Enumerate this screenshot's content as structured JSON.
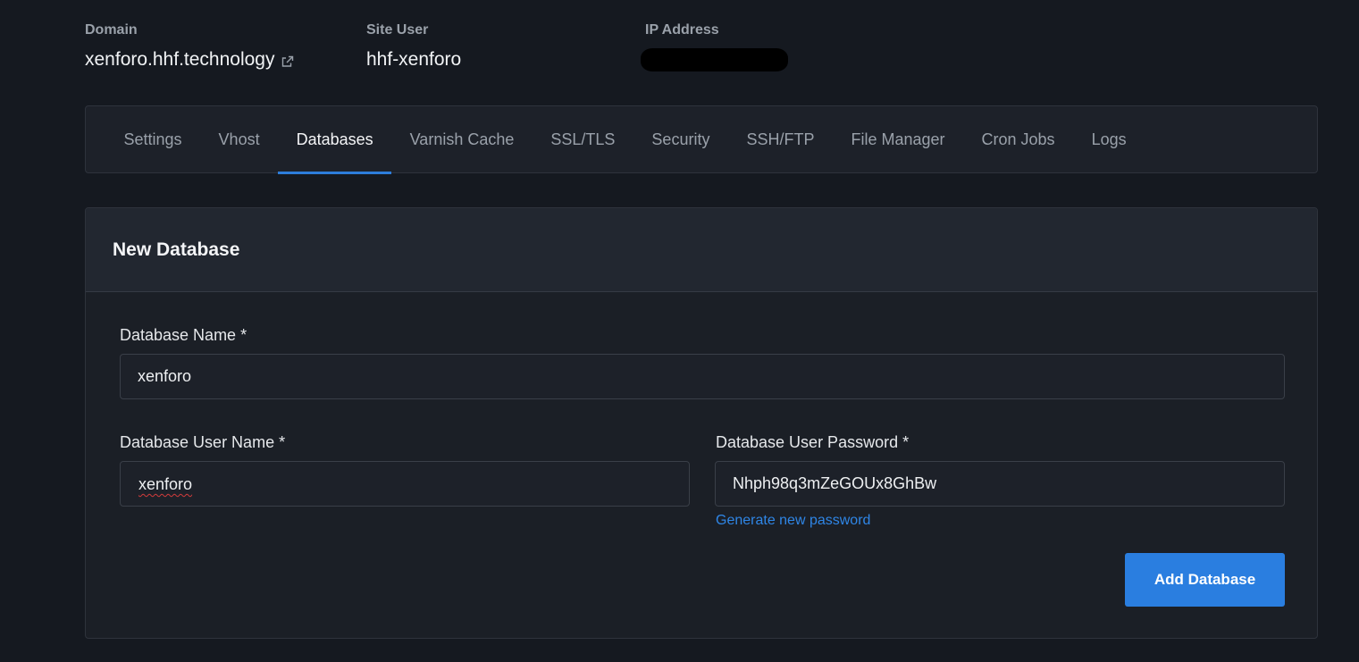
{
  "site_info": {
    "domain": {
      "label": "Domain",
      "value": "xenforo.hhf.technology",
      "icon": "external-link-icon"
    },
    "site_user": {
      "label": "Site User",
      "value": "hhf-xenforo"
    },
    "ip_address": {
      "label": "IP Address"
    }
  },
  "tabs": [
    {
      "label": "Settings",
      "active": false
    },
    {
      "label": "Vhost",
      "active": false
    },
    {
      "label": "Databases",
      "active": true
    },
    {
      "label": "Varnish Cache",
      "active": false
    },
    {
      "label": "SSL/TLS",
      "active": false
    },
    {
      "label": "Security",
      "active": false
    },
    {
      "label": "SSH/FTP",
      "active": false
    },
    {
      "label": "File Manager",
      "active": false
    },
    {
      "label": "Cron Jobs",
      "active": false
    },
    {
      "label": "Logs",
      "active": false
    }
  ],
  "form": {
    "title": "New Database",
    "database_name": {
      "label": "Database Name *",
      "value": "xenforo"
    },
    "database_user_name": {
      "label": "Database User Name *",
      "value": "xenforo"
    },
    "database_user_password": {
      "label": "Database User Password *",
      "value": "Nhph98q3mZeGOUx8GhBw"
    },
    "generate_password_link": "Generate new password",
    "submit_label": "Add Database"
  },
  "colors": {
    "background": "#151920",
    "accent": "#2a7ee0",
    "link": "#2f86e6"
  }
}
